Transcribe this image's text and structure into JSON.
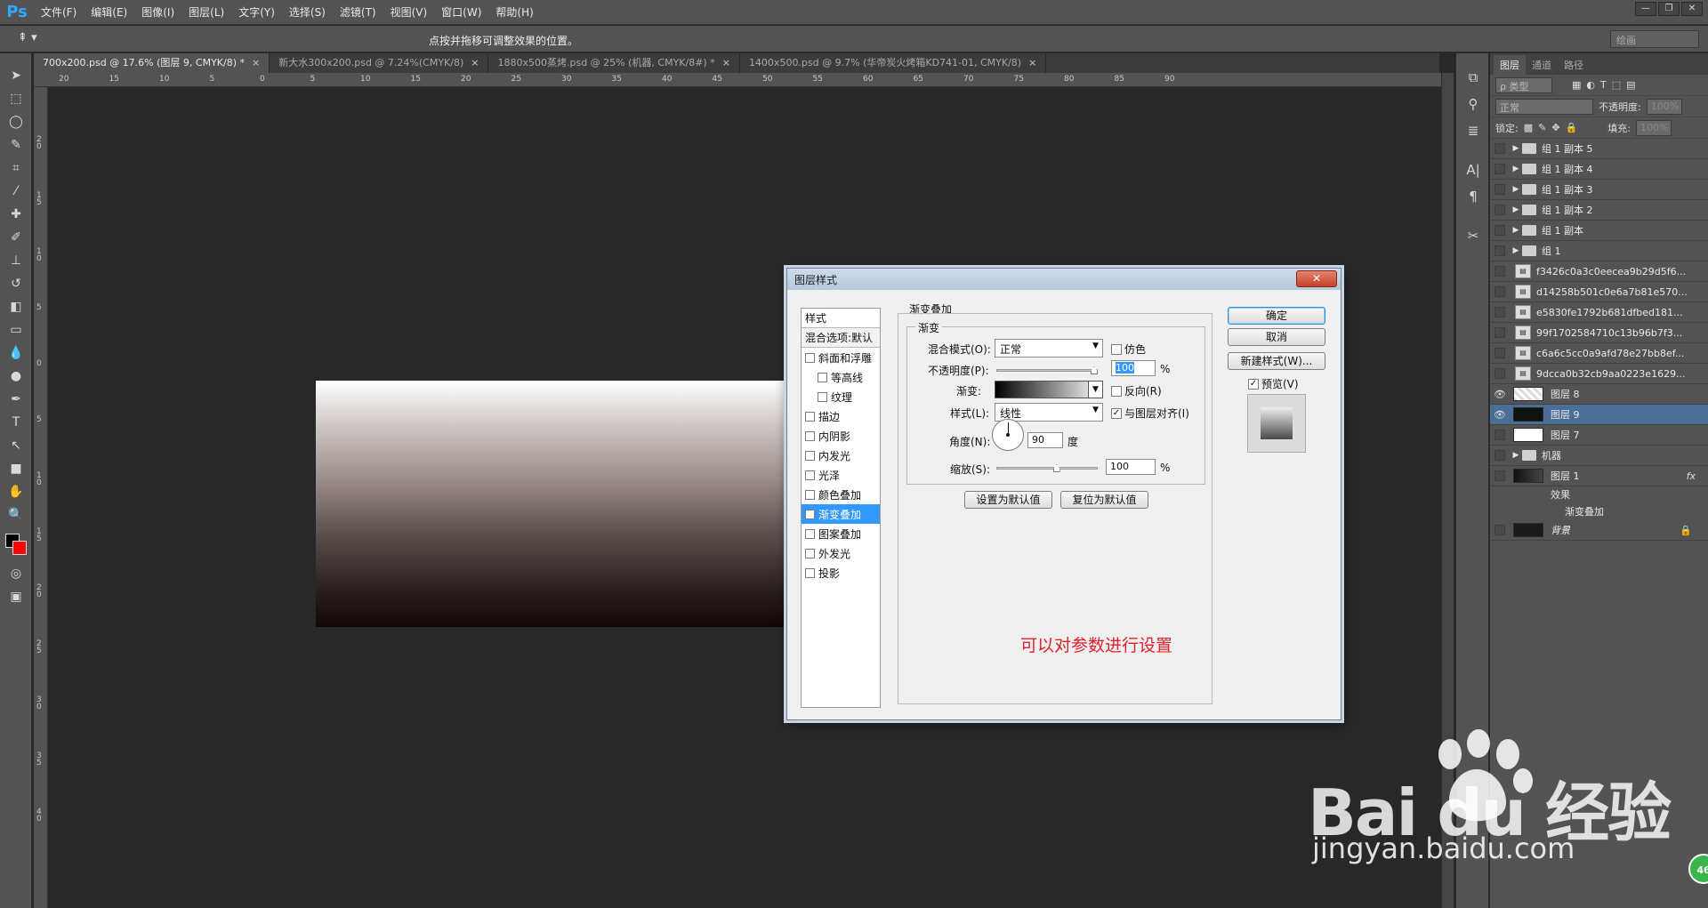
{
  "app": {
    "logo": "Ps",
    "menu": [
      "文件(F)",
      "编辑(E)",
      "图像(I)",
      "图层(L)",
      "文字(Y)",
      "选择(S)",
      "滤镜(T)",
      "视图(V)",
      "窗口(W)",
      "帮助(H)"
    ]
  },
  "options": {
    "hint": "点按并拖移可调整效果的位置。",
    "workspace": "绘画"
  },
  "tabs": [
    {
      "title": "700x200.psd @ 17.6% (图层 9, CMYK/8) *"
    },
    {
      "title": "新大水300x200.psd @ 7.24%(CMYK/8)"
    },
    {
      "title": "1880x500蒸烤.psd @ 25% (机器, CMYK/8#) *"
    },
    {
      "title": "1400x500.psd @ 9.7% (华帝炭火烤箱KD741-01, CMYK/8)"
    }
  ],
  "ruler_h_labels": [
    "20",
    "15",
    "10",
    "5",
    "0",
    "5",
    "10",
    "15",
    "20",
    "25",
    "30",
    "35",
    "40",
    "45",
    "50",
    "55",
    "60",
    "65",
    "70",
    "75",
    "80",
    "85",
    "90"
  ],
  "ruler_v_labels": [
    "2 0",
    "1 5",
    "1 0",
    "5",
    "0",
    "5",
    "1 0",
    "1 5",
    "2 0",
    "2 5",
    "3 0",
    "3 5",
    "4 0"
  ],
  "layers_panel": {
    "tabs": [
      "图层",
      "通道",
      "路径"
    ],
    "filter_label": "ρ 类型",
    "blend_mode": "正常",
    "opacity_label": "不透明度:",
    "opacity_value": "100%",
    "lock_label": "锁定:",
    "fill_label": "填充:",
    "fill_value": "100%",
    "layers": [
      {
        "name": "组 1 副本 5",
        "kind": "group",
        "visible": false
      },
      {
        "name": "组 1 副本 4",
        "kind": "group",
        "visible": false
      },
      {
        "name": "组 1 副本 3",
        "kind": "group",
        "visible": false
      },
      {
        "name": "组 1 副本 2",
        "kind": "group",
        "visible": false
      },
      {
        "name": "组 1 副本",
        "kind": "group",
        "visible": false
      },
      {
        "name": "组 1",
        "kind": "group",
        "visible": false
      },
      {
        "name": "f3426c0a3c0eecea9b29d5f6...",
        "kind": "smart",
        "visible": false
      },
      {
        "name": "d14258b501c0e6a7b81e570...",
        "kind": "smart",
        "visible": false
      },
      {
        "name": "e5830fe1792b681dfbed181...",
        "kind": "smart",
        "visible": false
      },
      {
        "name": "99f1702584710c13b96b7f3...",
        "kind": "smart",
        "visible": false
      },
      {
        "name": "c6a6c5cc0a9afd78e27bb8ef...",
        "kind": "smart",
        "visible": false
      },
      {
        "name": "9dcca0b32cb9aa0223e1629...",
        "kind": "smart",
        "visible": false
      },
      {
        "name": "图层 8",
        "kind": "pixel",
        "visible": true
      },
      {
        "name": "图层 9",
        "kind": "pixel",
        "visible": true,
        "selected": true
      },
      {
        "name": "图层 7",
        "kind": "pixel",
        "visible": false
      },
      {
        "name": "机器",
        "kind": "group",
        "visible": false
      },
      {
        "name": "图层 1",
        "kind": "pixel",
        "visible": false,
        "fx": "fx"
      },
      {
        "name": "背景",
        "kind": "background",
        "visible": false
      }
    ],
    "effects_label": "效果",
    "effect_item": "渐变叠加"
  },
  "dialog": {
    "title": "图层样式",
    "close": "✕",
    "styles_header": "样式",
    "blend_default": "混合选项:默认",
    "styles": [
      {
        "label": "斜面和浮雕",
        "checked": false,
        "indent": false
      },
      {
        "label": "等高线",
        "checked": false,
        "indent": true
      },
      {
        "label": "纹理",
        "checked": false,
        "indent": true
      },
      {
        "label": "描边",
        "checked": false,
        "indent": false
      },
      {
        "label": "内阴影",
        "checked": false,
        "indent": false
      },
      {
        "label": "内发光",
        "checked": false,
        "indent": false
      },
      {
        "label": "光泽",
        "checked": false,
        "indent": false
      },
      {
        "label": "颜色叠加",
        "checked": false,
        "indent": false
      },
      {
        "label": "渐变叠加",
        "checked": true,
        "indent": false,
        "selected": true
      },
      {
        "label": "图案叠加",
        "checked": false,
        "indent": false
      },
      {
        "label": "外发光",
        "checked": false,
        "indent": false
      },
      {
        "label": "投影",
        "checked": false,
        "indent": false
      }
    ],
    "section_title": "渐变叠加",
    "group_title": "渐变",
    "blend_mode_label": "混合模式(O):",
    "blend_mode_value": "正常",
    "dither_label": "仿色",
    "opacity_label": "不透明度(P):",
    "opacity_value": "100",
    "opacity_level": 1.0,
    "percent": "%",
    "gradient_label": "渐变:",
    "reverse_label": "反向(R)",
    "style_label": "样式(L):",
    "style_value": "线性",
    "align_label": "与图层对齐(I)",
    "align_checked": true,
    "angle_label": "角度(N):",
    "angle_value": "90",
    "degree": "度",
    "scale_label": "缩放(S):",
    "scale_value": "100",
    "scale_level": 0.6,
    "make_default": "设置为默认值",
    "reset_default": "复位为默认值",
    "ok": "确定",
    "cancel": "取消",
    "new_style": "新建样式(W)...",
    "preview_label": "预览(V)",
    "preview_checked": true,
    "hint": "可以对参数进行设置"
  },
  "watermark": {
    "brand": "Bai du 经验",
    "url": "jingyan.baidu.com",
    "badge": "46"
  },
  "colors": {
    "accent": "#3399ff",
    "selected_layer": "#4a6e95",
    "hint_red": "#e3202c",
    "foreground": "#000000",
    "background": "#ff0000"
  }
}
